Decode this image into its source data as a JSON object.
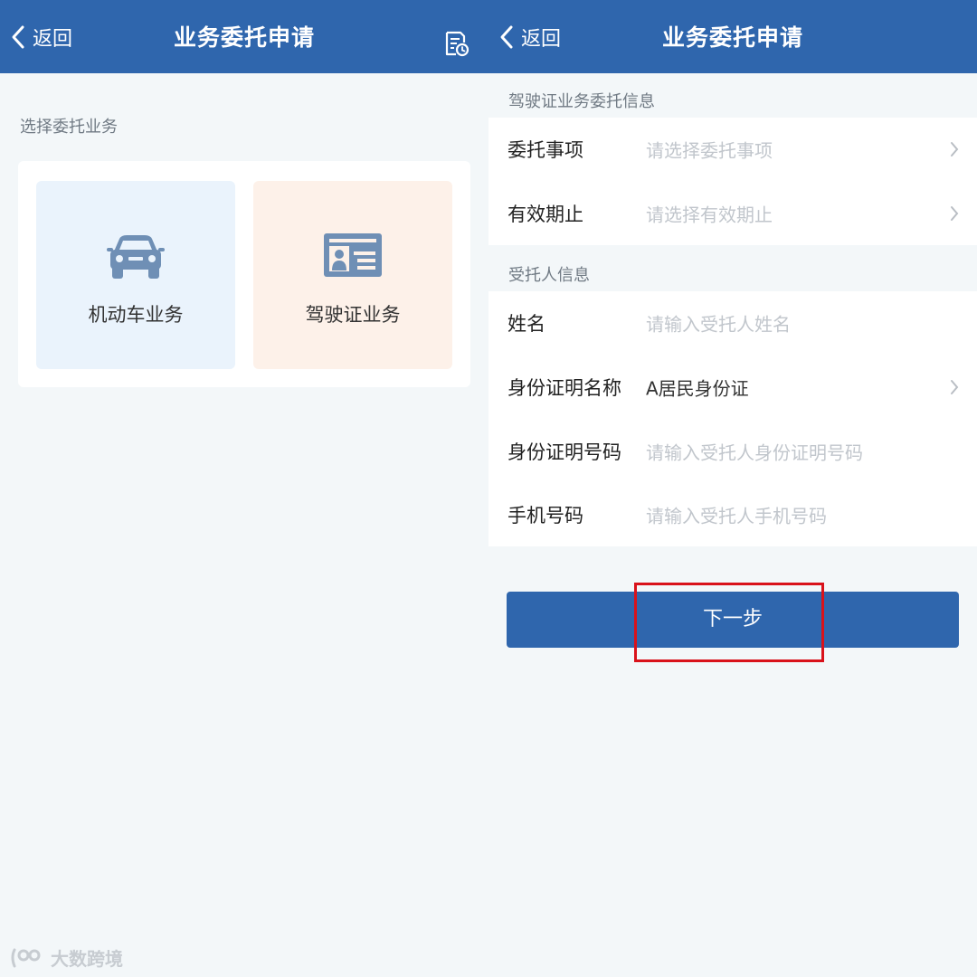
{
  "left": {
    "header": {
      "back_label": "返回",
      "title": "业务委托申请",
      "record_icon": "record-history-icon"
    },
    "section_label": "选择委托业务",
    "tiles": [
      {
        "label": "机动车业务",
        "icon": "car-icon",
        "color": "#eaf3fc"
      },
      {
        "label": "驾驶证业务",
        "icon": "id-card-icon",
        "color": "#fdf1e9"
      }
    ]
  },
  "right": {
    "header": {
      "back_label": "返回",
      "title": "业务委托申请"
    },
    "sections": [
      {
        "label": "驾驶证业务委托信息",
        "rows": [
          {
            "label": "委托事项",
            "value": "请选择委托事项"
          },
          {
            "label": "有效期止",
            "value": "请选择有效期止"
          }
        ]
      },
      {
        "label": "受托人信息",
        "rows": [
          {
            "label": "姓名",
            "value": "请输入受托人姓名"
          },
          {
            "label": "身份证明名称",
            "value": "A居民身份证"
          },
          {
            "label": "身份证明号码",
            "value": "请输入受托人身份证明号码"
          },
          {
            "label": "手机号码",
            "value": "请输入受托人手机号码"
          }
        ]
      }
    ],
    "next_button": "下一步"
  },
  "watermark": "大数跨境",
  "colors": {
    "primary": "#2f66ad",
    "highlight": "#d9121b",
    "background": "#f3f7f9"
  }
}
